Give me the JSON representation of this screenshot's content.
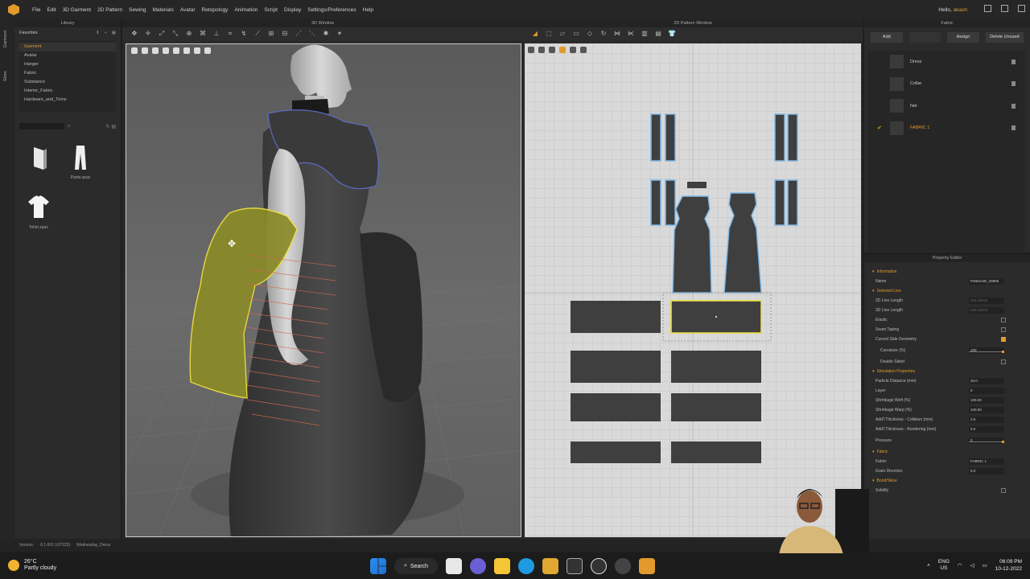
{
  "menu": {
    "items": [
      "File",
      "Edit",
      "3D Garment",
      "2D Pattern",
      "Sewing",
      "Materials",
      "Avatar",
      "Retopology",
      "Animation",
      "Script",
      "Display",
      "Settings/Preferences",
      "Help"
    ],
    "greeting": "Hello,",
    "user": "akash"
  },
  "side_tabs": [
    "Garment",
    "Store"
  ],
  "library": {
    "title": "Library",
    "favorites_label": "Favorites",
    "favorites": [
      "Garment",
      "Avatar",
      "Hanger",
      "Fabric",
      "Substance",
      "Interior_Fabric",
      "Hardware_and_Trims"
    ],
    "active_index": 0,
    "files": [
      {
        "name": ""
      },
      {
        "name": "Pants.zpac"
      },
      {
        "name": "Tshirt.zpac"
      }
    ]
  },
  "window3d": {
    "title": "3D Window"
  },
  "window2d": {
    "title": "2D Pattern Window"
  },
  "fabric": {
    "title": "Fabric",
    "buttons": [
      "Add",
      "",
      "Assign",
      "Delete Unused"
    ],
    "items": [
      {
        "name": "Dress",
        "checked": false
      },
      {
        "name": "Collar",
        "checked": false
      },
      {
        "name": "Net",
        "checked": false
      },
      {
        "name": "FABRIC 1",
        "checked": true
      }
    ]
  },
  "property_editor": {
    "title": "Property Editor",
    "rows": [
      {
        "type": "section",
        "label": "Information"
      },
      {
        "type": "field",
        "label": "Name",
        "value": "Pattern2D_26865"
      },
      {
        "type": "section",
        "label": "Selected Line"
      },
      {
        "type": "field",
        "label": "2D Line Length",
        "value": "341.15mm",
        "dim": true
      },
      {
        "type": "field",
        "label": "3D Line Length",
        "value": "269.22mm",
        "dim": true
      },
      {
        "type": "check",
        "label": "Elastic",
        "on": false
      },
      {
        "type": "check",
        "label": "Seam Taping",
        "on": false
      },
      {
        "type": "check",
        "label": "Curved Side Geometry",
        "on": true
      },
      {
        "type": "field",
        "label": "Curvature (%)",
        "value": "100",
        "sub": true,
        "slider": true
      },
      {
        "type": "check",
        "label": "Double Sided",
        "on": false,
        "sub": true
      },
      {
        "type": "section",
        "label": "Simulation Properties"
      },
      {
        "type": "field",
        "label": "Particle Distance (mm)",
        "value": "20.0"
      },
      {
        "type": "field",
        "label": "Layer",
        "value": "0"
      },
      {
        "type": "field",
        "label": "Shrinkage Weft (%)",
        "value": "100.00"
      },
      {
        "type": "field",
        "label": "Shrinkage Warp (%)",
        "value": "100.00"
      },
      {
        "type": "field",
        "label": "Add'l Thickness - Collision (mm)",
        "value": "2.5"
      },
      {
        "type": "field",
        "label": "Add'l Thickness - Rendering (mm)",
        "value": "0.0"
      },
      {
        "type": "field",
        "label": "Pressure",
        "value": "0",
        "slider": true
      },
      {
        "type": "section",
        "label": "Fabric"
      },
      {
        "type": "field",
        "label": "Fabric",
        "value": "FABRIC 1"
      },
      {
        "type": "field",
        "label": "Grain Direction",
        "value": "0.0"
      },
      {
        "type": "section",
        "label": "Bond/Skive"
      },
      {
        "type": "check",
        "label": "Solidify",
        "on": false
      }
    ]
  },
  "status": {
    "version_label": "Version:",
    "version": "6.1.601 (r37223)",
    "file": "Wednesday_Dress"
  },
  "taskbar": {
    "temp": "26°C",
    "weather": "Partly cloudy",
    "search": "Search",
    "lang1": "ENG",
    "lang2": "US",
    "time": "06:09 PM",
    "date": "10-12-2022"
  },
  "colors": {
    "accent": "#e39a2c",
    "selection": "#e9e03a",
    "pattern": "#3f3f3f",
    "outline": "#7fb8e8"
  }
}
